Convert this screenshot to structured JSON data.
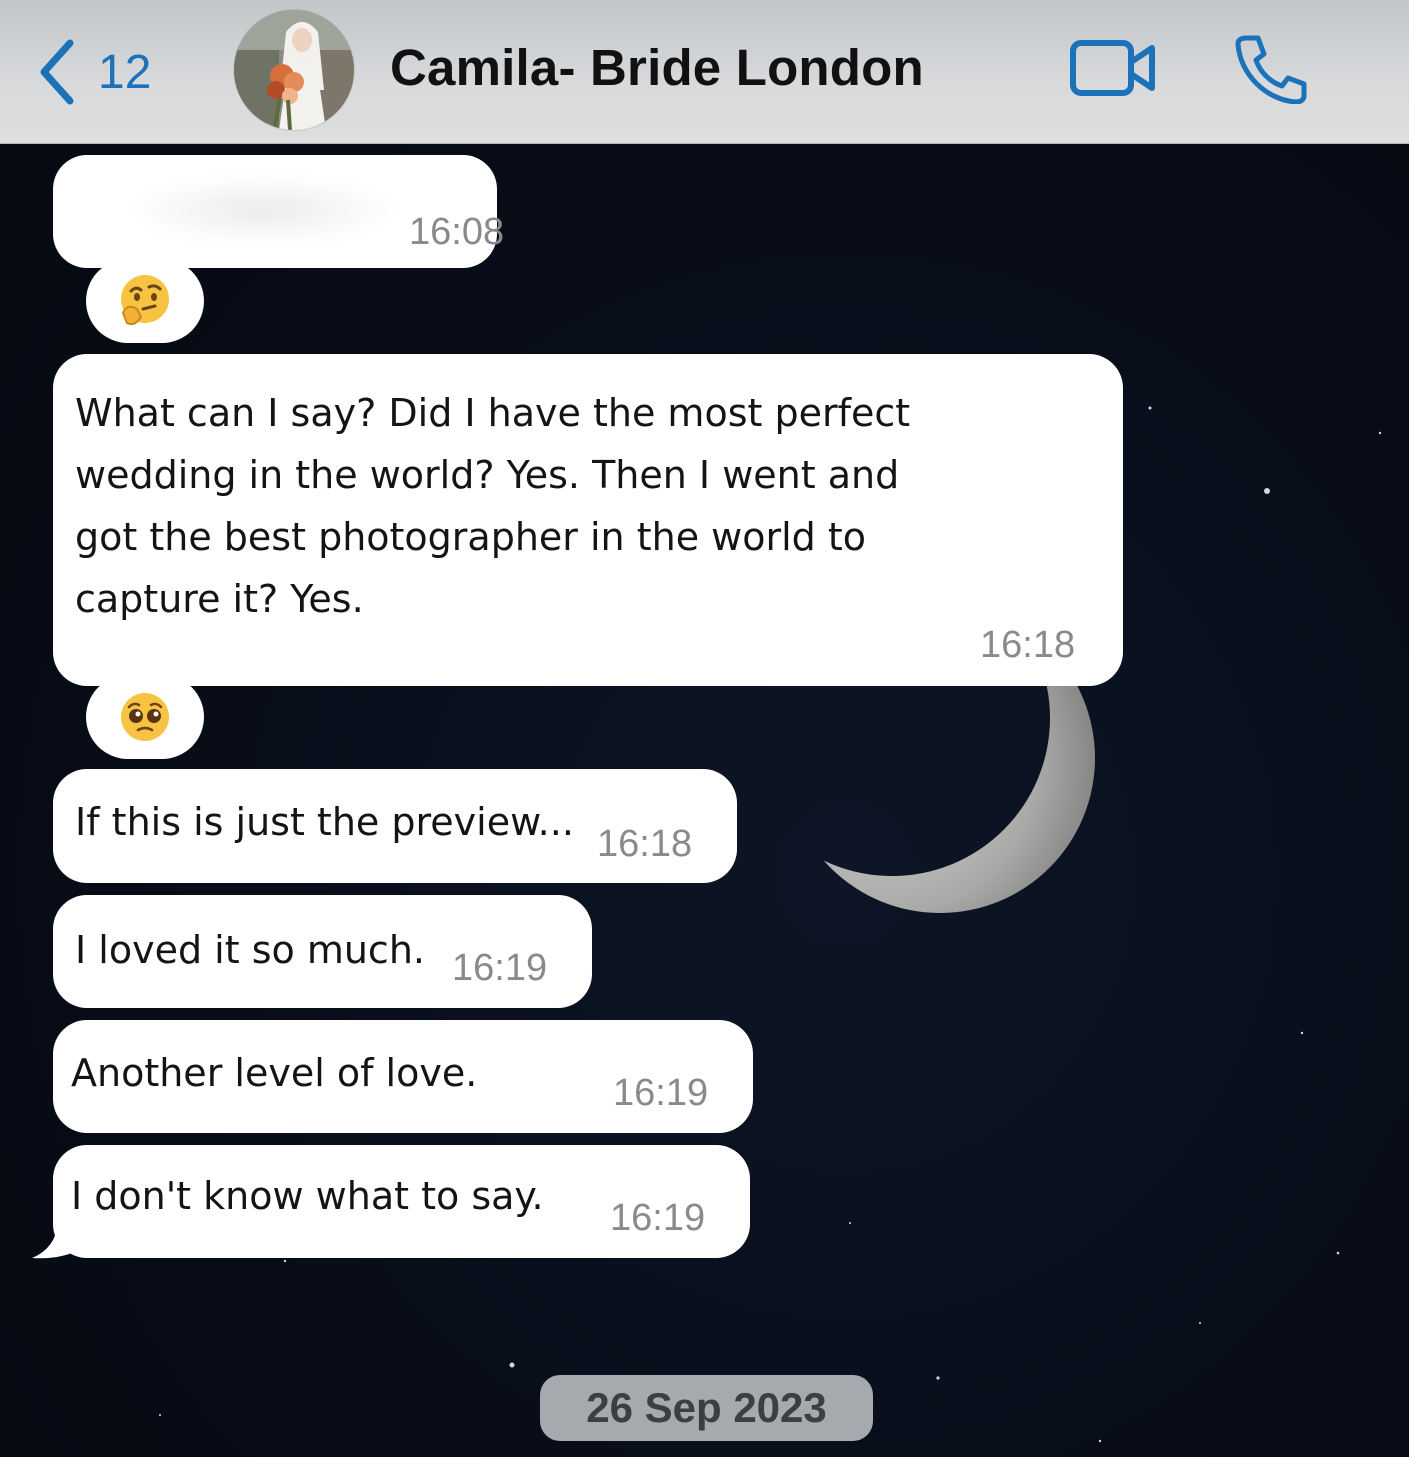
{
  "header": {
    "unread_count": "12",
    "contact_name": "Camila- Bride London",
    "avatar_icon": "bride-photo-avatar",
    "video_icon": "video-camera-icon",
    "call_icon": "phone-icon",
    "accent_color": "#1c72b8"
  },
  "messages": [
    {
      "text": "",
      "time": "16:08",
      "note": ""
    },
    {
      "reaction": "thinking-face"
    },
    {
      "text_lines": [
        "What can I say? Did I have the most perfect",
        "wedding in the world? Yes. Then I went and",
        "got the best photographer in the world to",
        "capture it? Yes."
      ],
      "time": "16:18"
    },
    {
      "reaction": "pleading-face"
    },
    {
      "text": "If this is just the preview...",
      "time": "16:18"
    },
    {
      "text": "I loved it so much.",
      "time": "16:19"
    },
    {
      "text": "Another level of love.",
      "time": "16:19"
    },
    {
      "text": "I don't know what to say.",
      "time": "16:19"
    }
  ],
  "date_separator": "26 Sep 2023",
  "background": "night-sky-crescent-moon"
}
